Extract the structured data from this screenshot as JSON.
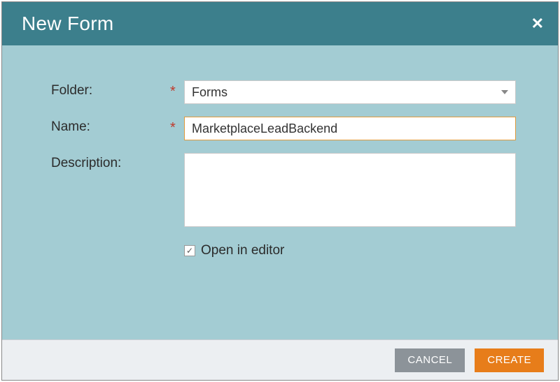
{
  "dialog": {
    "title": "New Form",
    "fields": {
      "folder": {
        "label": "Folder:",
        "value": "Forms"
      },
      "name": {
        "label": "Name:",
        "value": "MarketplaceLeadBackend"
      },
      "description": {
        "label": "Description:",
        "value": ""
      },
      "open_in_editor": {
        "label": "Open in editor",
        "checked": true
      }
    },
    "buttons": {
      "cancel": "CANCEL",
      "create": "CREATE"
    }
  }
}
